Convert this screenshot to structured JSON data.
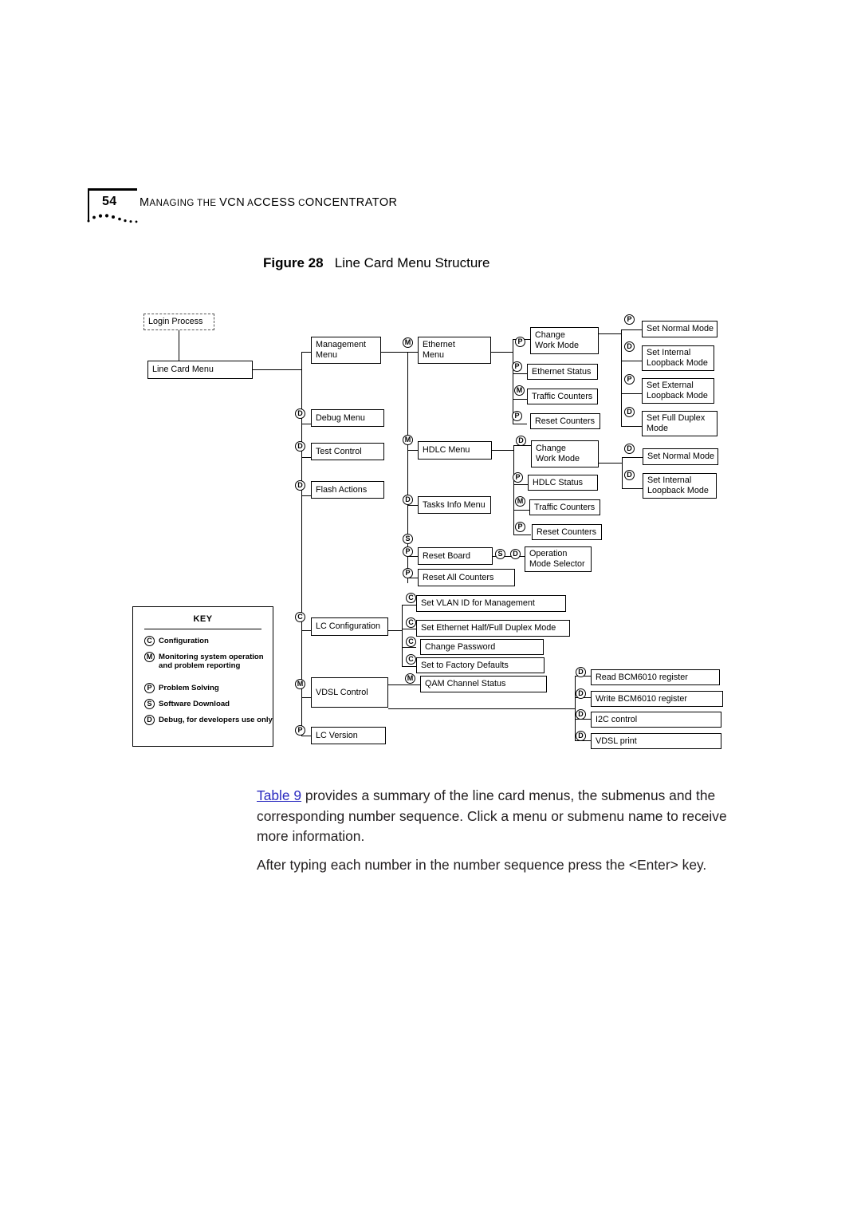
{
  "header": {
    "page_number": "54",
    "running_head_parts": [
      "M",
      "ANAGING THE ",
      "VCN",
      "A",
      "CCESS ",
      "C",
      "ONCENTRATOR"
    ],
    "running_head": "MANAGING THE VCN ACCESS CONCENTRATOR"
  },
  "figure": {
    "label": "Figure 28",
    "title": "Line Card Menu Structure"
  },
  "nodes": {
    "login_process": "Login Process",
    "line_card_menu": "Line Card Menu",
    "management_menu": "Management\nMenu",
    "debug_menu": "Debug Menu",
    "test_control": "Test Control",
    "flash_actions": "Flash Actions",
    "ethernet_menu": "Ethernet\nMenu",
    "hdlc_menu": "HDLC Menu",
    "tasks_info_menu": "Tasks Info Menu",
    "reset_board": "Reset Board",
    "reset_all_counters": "Reset All Counters",
    "lc_configuration": "LC Configuration",
    "vdsl_control": "VDSL Control",
    "lc_version": "LC Version",
    "eth_change_work_mode": "Change\nWork Mode",
    "ethernet_status": "Ethernet Status",
    "eth_traffic_counters": "Traffic Counters",
    "eth_reset_counters": "Reset Counters",
    "hdlc_change_work_mode": "Change\nWork Mode",
    "hdlc_status": "HDLC Status",
    "hdlc_traffic_counters": "Traffic Counters",
    "hdlc_reset_counters": "Reset Counters",
    "operation_mode_selector": "Operation\nMode Selector",
    "set_vlan_id": "Set VLAN ID for Management",
    "set_eth_duplex": "Set Ethernet Half/Full Duplex Mode",
    "change_password": "Change Password",
    "set_factory_defaults": "Set to Factory Defaults",
    "qam_channel_status": "QAM Channel Status",
    "eth_set_normal_mode": "Set Normal Mode",
    "eth_set_internal_loopback": "Set Internal\nLoopback  Mode",
    "eth_set_external_loopback": "Set External\nLoopback  Mode",
    "eth_set_full_duplex": "Set Full Duplex\nMode",
    "hdlc_set_normal_mode": "Set Normal Mode",
    "hdlc_set_internal_loopback": "Set Internal\nLoopback  Mode",
    "read_bcm6010": "Read BCM6010 register",
    "write_bcm6010": "Write BCM6010 register",
    "i2c_control": "I2C control",
    "vdsl_print": "VDSL print"
  },
  "badges": {
    "management_menu": "M",
    "debug_menu": "D",
    "test_control": "D",
    "flash_actions": "D",
    "ethernet_menu": "M",
    "hdlc_menu": "M",
    "tasks_info_menu": "D",
    "reset_board_s": "S",
    "reset_board": "P",
    "reset_all_counters": "P",
    "lc_configuration": "C",
    "vdsl_control": "M",
    "lc_version": "P",
    "eth_change_work_mode": "P",
    "ethernet_status": "P",
    "eth_traffic_counters": "M",
    "eth_reset_counters": "P",
    "hdlc_change_work_mode": "D",
    "hdlc_status": "P",
    "hdlc_traffic_counters": "M",
    "hdlc_reset_counters": "P",
    "operation_mode_selector_s": "S",
    "operation_mode_selector_d": "D",
    "set_vlan_id": "C",
    "set_eth_duplex": "C",
    "change_password": "C",
    "set_factory_defaults": "C",
    "qam_channel_status": "M",
    "eth_set_normal_mode": "P",
    "eth_set_internal_loopback": "D",
    "eth_set_external_loopback": "P",
    "eth_set_full_duplex": "D",
    "hdlc_set_normal_mode": "D",
    "hdlc_set_internal_loopback": "D",
    "read_bcm6010": "D",
    "write_bcm6010": "D",
    "i2c_control": "D",
    "vdsl_print": "D"
  },
  "key": {
    "title": "KEY",
    "items": [
      {
        "badge": "C",
        "text": "Configuration"
      },
      {
        "badge": "M",
        "text": "Monitoring system operation and problem reporting"
      },
      {
        "badge": "P",
        "text": "Problem Solving"
      },
      {
        "badge": "S",
        "text": "Software Download"
      },
      {
        "badge": "D",
        "text": "Debug, for developers use only"
      }
    ]
  },
  "body": {
    "link_text": "Table 9",
    "para1_rest": " provides a summary of the line card menus, the submenus and the corresponding number sequence. Click a menu or submenu name to receive more information.",
    "para2": "After typing each number in the number sequence press the <Enter> key."
  }
}
